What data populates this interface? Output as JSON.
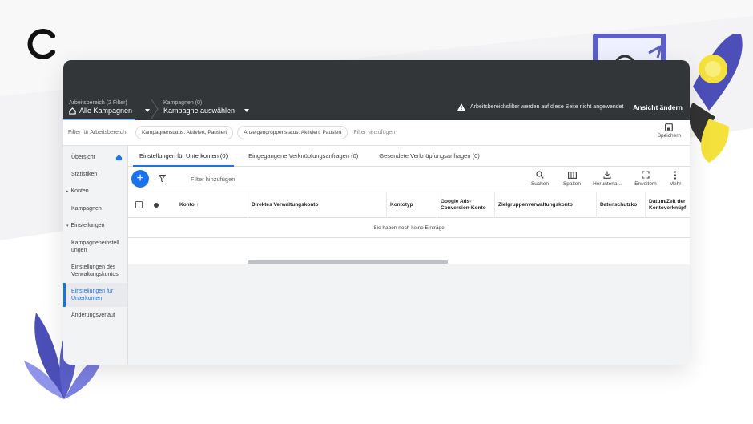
{
  "topbar": {
    "workspace_small": "Arbeitsbereich (2 Filter)",
    "workspace_big": "Alle Kampagnen",
    "campaign_small": "Kampagnen (0)",
    "campaign_big": "Kampagne auswählen",
    "warning_text": "Arbeitsbereichsfilter werden auf diese Seite nicht angewendet",
    "view_button": "Ansicht ändern"
  },
  "filterbar": {
    "label": "Filter für Arbeitsbereich",
    "chips": [
      "Kampagnenstatus: Aktiviert, Pausiert",
      "Anzeigengruppenstatus: Aktiviert, Pausiert"
    ],
    "add_filter": "Filter hinzufügen",
    "save_label": "Speichern"
  },
  "sidebar": {
    "items": [
      {
        "label": "Übersicht"
      },
      {
        "label": "Statistiken"
      },
      {
        "label": "Konten"
      },
      {
        "label": "Kampagnen"
      },
      {
        "label": "Einstellungen"
      },
      {
        "label": "Kampagneneinstell ungen"
      },
      {
        "label": "Einstellungen des Verwaltungskontos"
      },
      {
        "label": "Einstellungen für Unterkonten"
      },
      {
        "label": "Änderungsverlauf"
      }
    ]
  },
  "tabs": [
    {
      "label": "Einstellungen für Unterkonten (0)"
    },
    {
      "label": "Eingegangene Verknüpfungsanfragen (0)"
    },
    {
      "label": "Gesendete Verknüpfungsanfragen (0)"
    }
  ],
  "toolbar": {
    "add_symbol": "+",
    "filter_text": "Filter hinzufügen",
    "search": "Suchen",
    "columns": "Spalten",
    "download": "Herunterla...",
    "expand": "Erweitern",
    "more": "Mehr"
  },
  "table": {
    "headers": [
      "Konto ↑",
      "Direktes Verwaltungskonto",
      "Kontotyp",
      "Google Ads-Conversion-Konto",
      "Zielgruppenverwaltungskonto",
      "Datenschutzko",
      "Datum/Zeit der Kontoverknüpf"
    ],
    "empty_message": "Sie haben noch keine Einträge"
  },
  "colors": {
    "accent": "#1a73e8",
    "topbar": "#323639",
    "brand_purple": "#5b5fc7",
    "brand_yellow": "#f5e13b"
  }
}
